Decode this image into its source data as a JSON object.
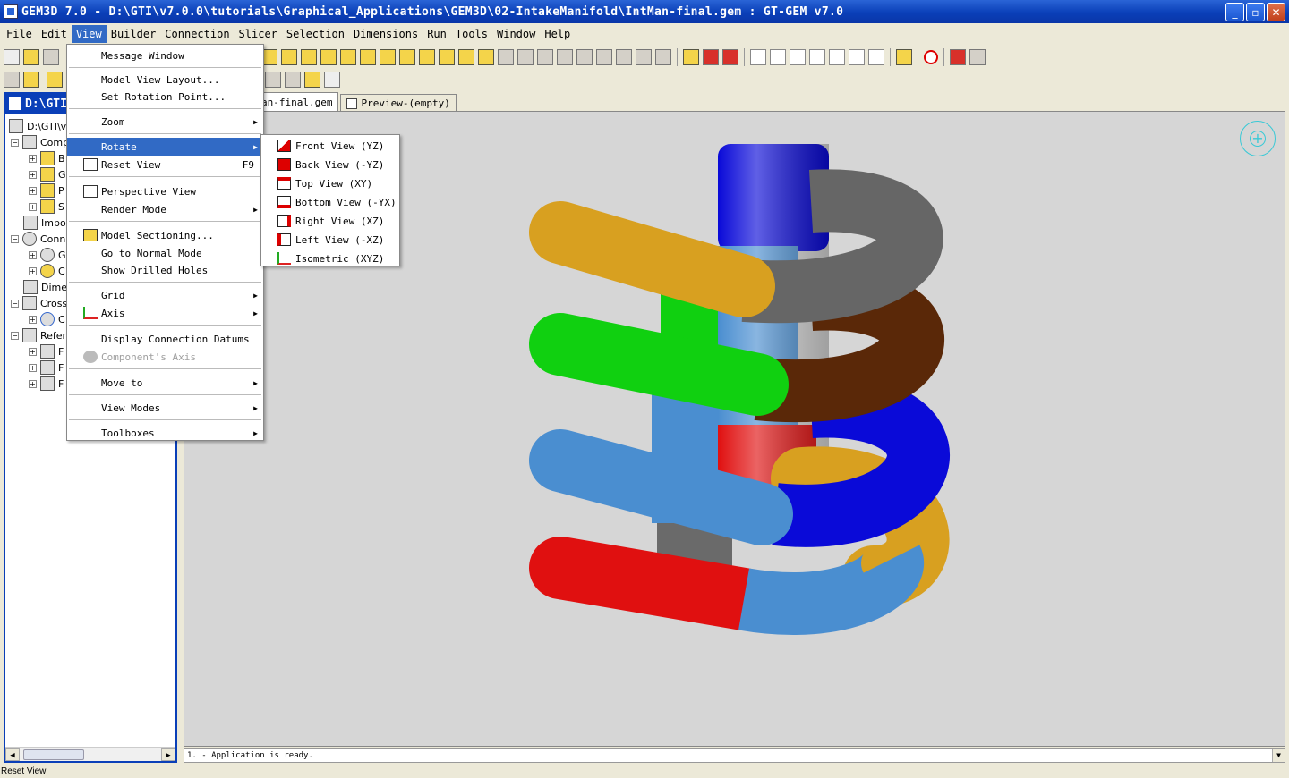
{
  "window": {
    "title": "GEM3D 7.0 - D:\\GTI\\v7.0.0\\tutorials\\Graphical_Applications\\GEM3D\\02-IntakeManifold\\IntMan-final.gem : GT-GEM v7.0",
    "minimize": "_",
    "maximize": "▫",
    "close": "✕"
  },
  "menubar": [
    "File",
    "Edit",
    "View",
    "Builder",
    "Connection",
    "Slicer",
    "Selection",
    "Dimensions",
    "Run",
    "Tools",
    "Window",
    "Help"
  ],
  "left_panel": {
    "title": "D:\\GTI",
    "tree": [
      "D:\\GTI\\v",
      "Comp",
      "B",
      "G",
      "P",
      "S",
      "Impo",
      "Conn",
      "G",
      "C",
      "Dimer",
      "Cross",
      "C",
      "Refer",
      "F",
      "F",
      "F"
    ]
  },
  "tabs": [
    "an-final.gem",
    "Preview-(empty)"
  ],
  "view_menu": {
    "items": [
      "Message Window",
      "Model View Layout...",
      "Set Rotation Point...",
      "Zoom",
      "Rotate",
      "Reset View",
      "Perspective View",
      "Render Mode",
      "Model Sectioning...",
      "Go to Normal Mode",
      "Show Drilled Holes",
      "Grid",
      "Axis",
      "Display Connection Datums",
      "Component's Axis",
      "Move to",
      "View Modes",
      "Toolboxes"
    ],
    "reset_shortcut": "F9"
  },
  "rotate_menu": {
    "items": [
      "Front View (YZ)",
      "Back View (-YZ)",
      "Top View (XY)",
      "Bottom View (-YX)",
      "Right View (XZ)",
      "Left View (-XZ)",
      "Isometric (XYZ)"
    ]
  },
  "message_bar": "1. - Application is ready.",
  "status_bar": "Reset View",
  "colors": {
    "highlight": "#316ac5",
    "title_blue": "#0a3fb8",
    "pipe_gold": "#d8a020",
    "pipe_gray": "#666666",
    "pipe_green": "#10d010",
    "pipe_brown": "#5a2808",
    "pipe_lightblue": "#4a8ed0",
    "pipe_blue": "#0a0ad8",
    "pipe_red": "#e01010"
  }
}
